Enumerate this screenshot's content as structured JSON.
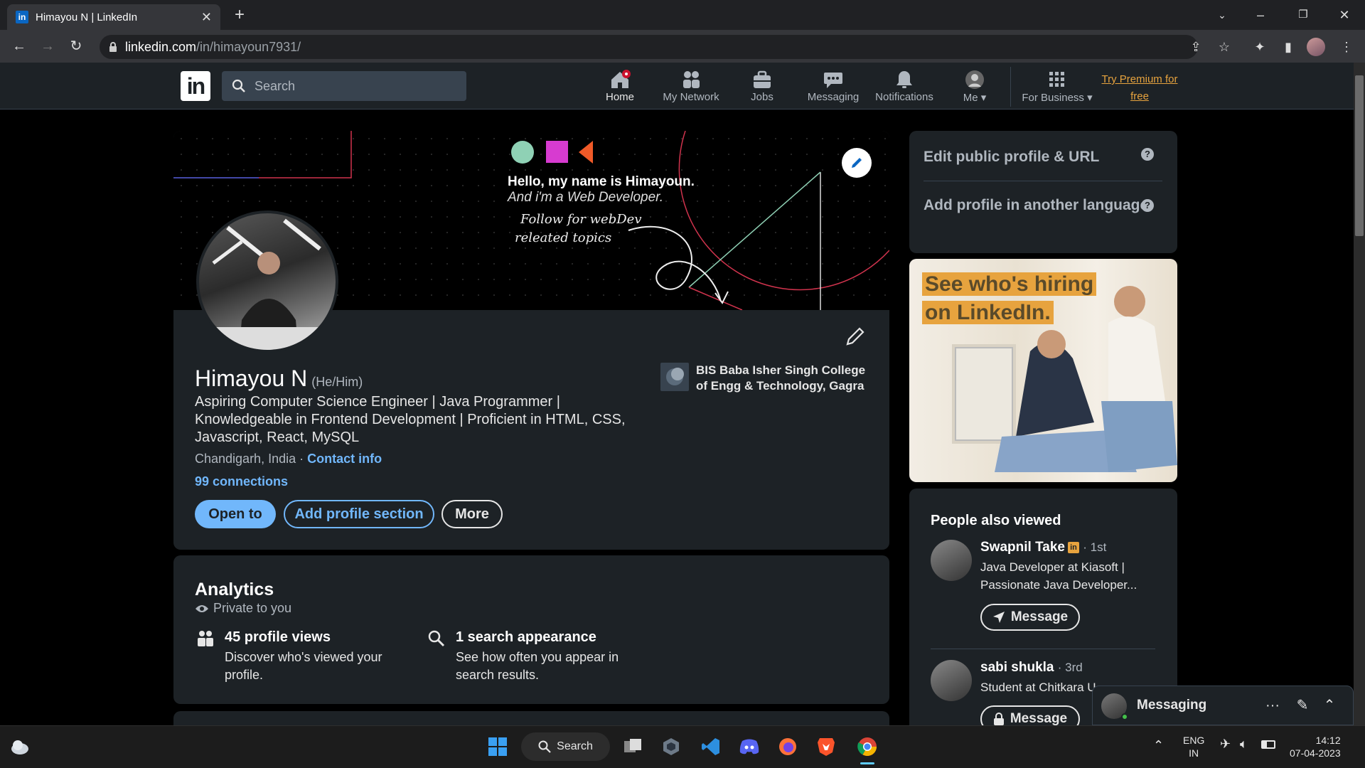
{
  "browser": {
    "tab_title": "Himayou N | LinkedIn",
    "url_host": "linkedin.com",
    "url_path": "/in/himayoun7931/"
  },
  "nav": {
    "search_placeholder": "Search",
    "items": [
      {
        "label": "Home",
        "icon": "home-icon",
        "badge": true
      },
      {
        "label": "My Network",
        "icon": "network-icon"
      },
      {
        "label": "Jobs",
        "icon": "briefcase-icon"
      },
      {
        "label": "Messaging",
        "icon": "chat-icon"
      },
      {
        "label": "Notifications",
        "icon": "bell-icon"
      },
      {
        "label": "Me",
        "icon": "avatar"
      },
      {
        "label": "For Business",
        "icon": "grid-icon"
      }
    ],
    "premium": "Try Premium for free"
  },
  "banner": {
    "line1": "Hello, my name is Himayoun.",
    "line2": "And i'm a Web Developer.",
    "line3": "Follow for webDev",
    "line4": "releated topics"
  },
  "profile": {
    "name": "Himayou N",
    "pronouns": "(He/Him)",
    "headline": "Aspiring Computer Science Engineer | Java Programmer | Knowledgeable in Frontend Development | Proficient in HTML, CSS, Javascript, React, MySQL",
    "location": "Chandigarh, India",
    "location_sep": " · ",
    "contact": "Contact info",
    "connections": "99 connections",
    "buttons": {
      "open": "Open to",
      "add": "Add profile section",
      "more": "More"
    },
    "school": "BIS Baba Isher Singh College of Engg & Technology, Gagra"
  },
  "analytics": {
    "title": "Analytics",
    "private": "Private to you",
    "items": [
      {
        "title": "45 profile views",
        "desc": "Discover who's viewed your profile."
      },
      {
        "title": "1 search appearance",
        "desc": "See how often you appear in search results."
      }
    ]
  },
  "sidebar": {
    "edit_public": "Edit public profile & URL",
    "add_language": "Add profile in another language",
    "ad_line1": "See who's hiring",
    "ad_line2": "on LinkedIn.",
    "pav_title": "People also viewed",
    "people": [
      {
        "name": "Swapnil Take",
        "degree": "· 1st",
        "headline1": "Java Developer at Kiasoft |",
        "headline2": "Passionate Java Developer...",
        "button": "Message"
      },
      {
        "name": "sabi shukla",
        "degree": "· 3rd",
        "headline1": "Student at Chitkara U",
        "button": "Message"
      }
    ]
  },
  "messaging": {
    "label": "Messaging"
  },
  "taskbar": {
    "search": "Search",
    "lang1": "ENG",
    "lang2": "IN",
    "time": "14:12",
    "date": "07-04-2023"
  },
  "colors": {
    "accent": "#71b7fb",
    "premium": "#e7a33e",
    "card": "#1d2226"
  }
}
